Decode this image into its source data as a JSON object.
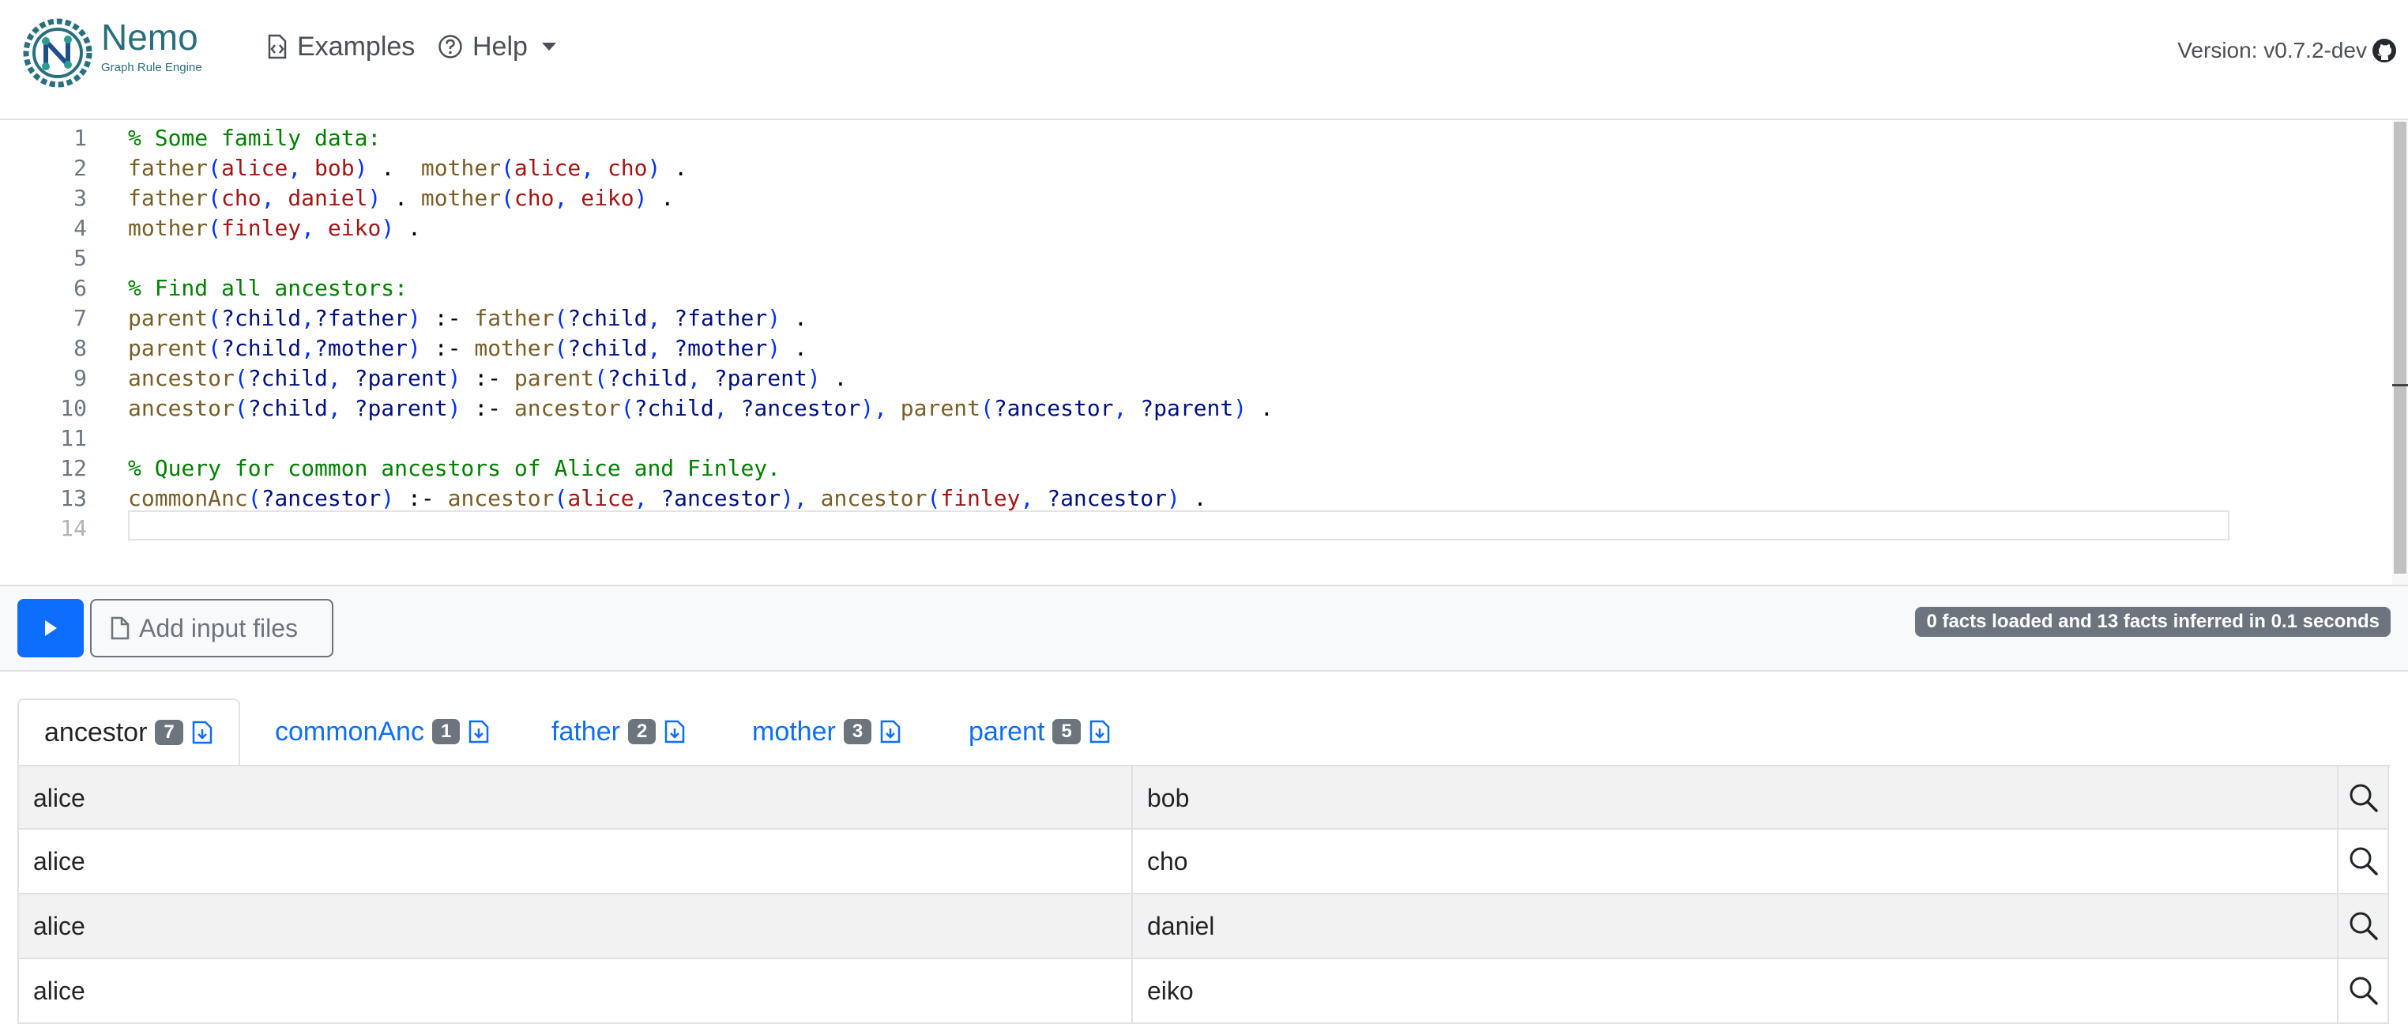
{
  "header": {
    "brand_name": "Nemo",
    "brand_sub": "Graph Rule Engine",
    "nav_examples": "Examples",
    "nav_help": "Help",
    "version": "Version: v0.7.2-dev"
  },
  "editor": {
    "line_numbers": [
      "1",
      "2",
      "3",
      "4",
      "5",
      "6",
      "7",
      "8",
      "9",
      "10",
      "11",
      "12",
      "13",
      "14"
    ]
  },
  "toolbar": {
    "add_input_files": "Add input files",
    "status": "0 facts loaded and 13 facts inferred in 0.1 seconds"
  },
  "tabs": [
    {
      "label": "ancestor",
      "count": "7"
    },
    {
      "label": "commonAnc",
      "count": "1"
    },
    {
      "label": "father",
      "count": "2"
    },
    {
      "label": "mother",
      "count": "3"
    },
    {
      "label": "parent",
      "count": "5"
    }
  ],
  "table": {
    "rows": [
      [
        "alice",
        "bob"
      ],
      [
        "alice",
        "cho"
      ],
      [
        "alice",
        "daniel"
      ],
      [
        "alice",
        "eiko"
      ]
    ]
  },
  "colors": {
    "primary": "#0d6efd",
    "secondary": "#6c757d",
    "brand": "#2a6f7e"
  }
}
